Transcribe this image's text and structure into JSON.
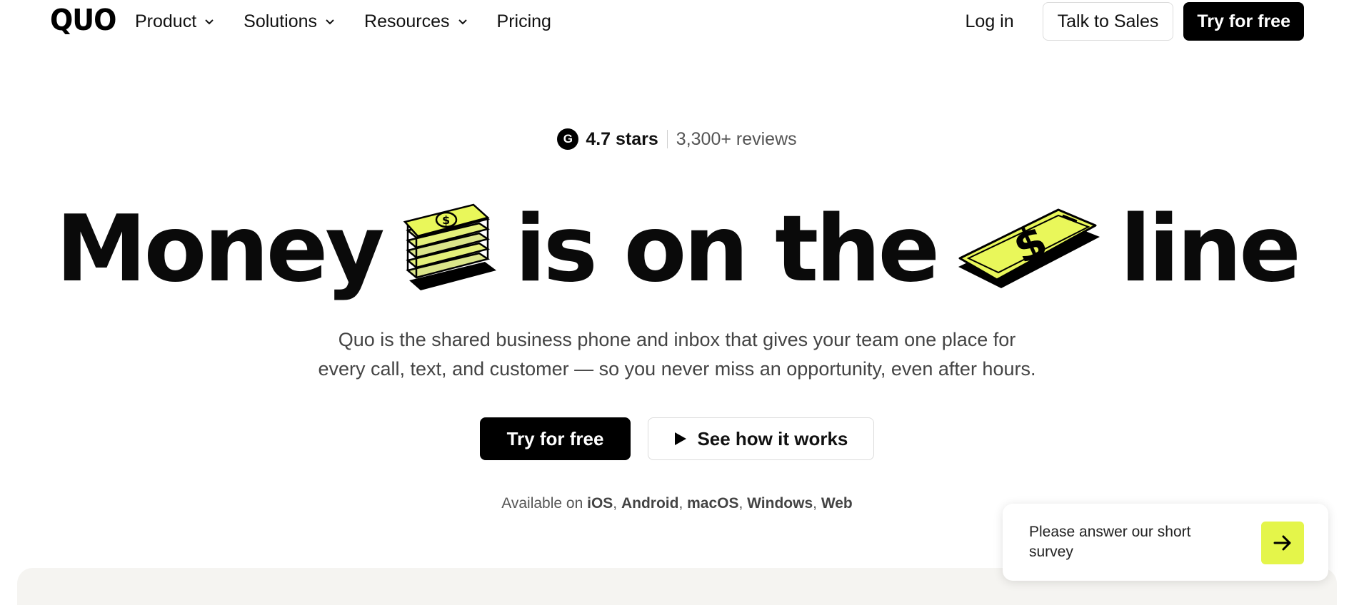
{
  "nav": {
    "logo": "QUO",
    "links": [
      {
        "label": "Product",
        "dropdown": true
      },
      {
        "label": "Solutions",
        "dropdown": true
      },
      {
        "label": "Resources",
        "dropdown": true
      },
      {
        "label": "Pricing",
        "dropdown": false
      }
    ],
    "login": "Log in",
    "talk_to_sales": "Talk to Sales",
    "try_free": "Try for free"
  },
  "rating": {
    "badge": "G",
    "stars": "4.7 stars",
    "reviews": "3,300+ reviews"
  },
  "hero": {
    "word_money": "Money",
    "word_middle": "is on the",
    "word_line": "line",
    "illustrations": [
      "cash-stack-icon",
      "phone-dollar-icon"
    ],
    "sub_line1": "Quo is the shared business phone and inbox that gives your team one place for",
    "sub_line2": "every call, text, and customer — so you never miss an opportunity, even after hours."
  },
  "cta": {
    "primary": "Try for free",
    "secondary": "See how it works"
  },
  "platforms": {
    "prefix": "Available on",
    "items": [
      "iOS",
      "Android",
      "macOS",
      "Windows",
      "Web"
    ]
  },
  "survey": {
    "text": "Please answer our short survey"
  },
  "colors": {
    "accent": "#e4f54a",
    "dark": "#000000",
    "panel": "#f5f4f1"
  }
}
